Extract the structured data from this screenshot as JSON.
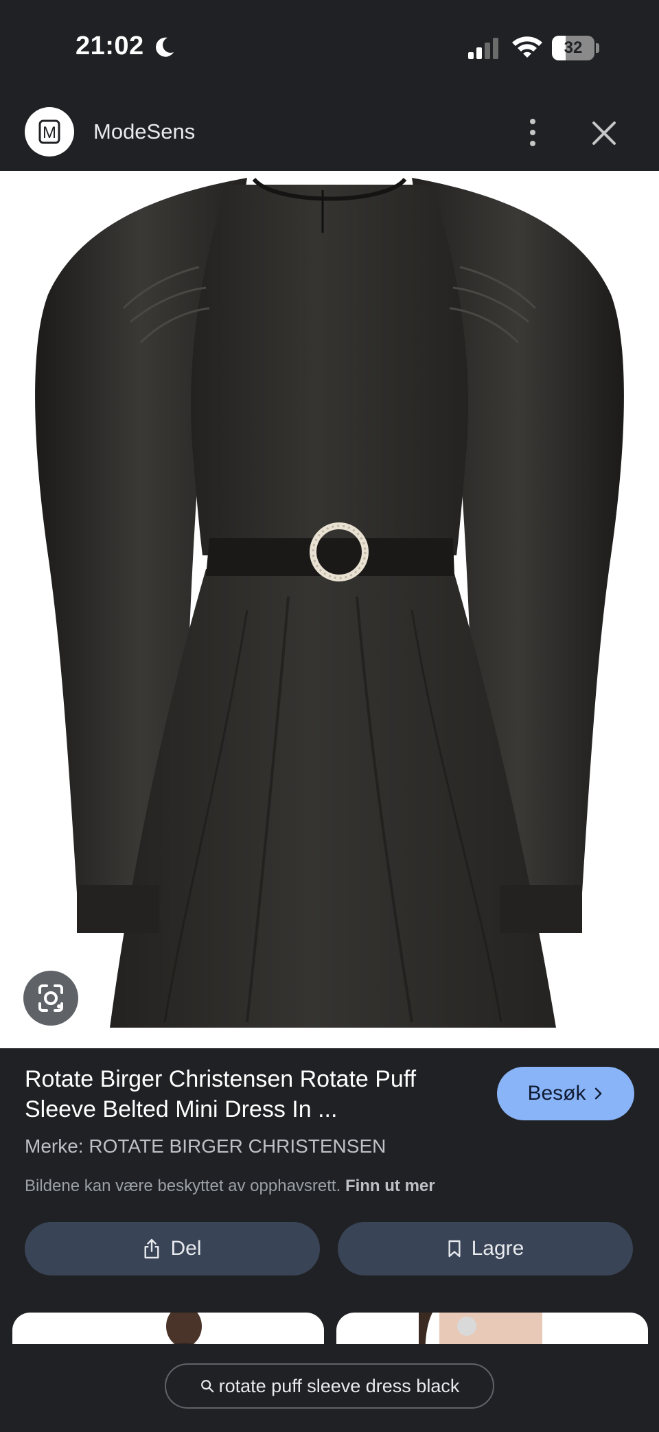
{
  "status_bar": {
    "time": "21:02",
    "battery_level": "32",
    "icons": [
      "moon-icon",
      "signal-icon",
      "wifi-icon",
      "battery-icon"
    ]
  },
  "header": {
    "site_name": "ModeSens",
    "logo_letter": "M",
    "icons": [
      "more-vert-icon",
      "close-icon"
    ]
  },
  "product": {
    "image_description_icon": "lens-icon",
    "title": "Rotate Birger Christensen Rotate Puff Sleeve Belted Mini Dress In ...",
    "visit_label": "Besøk",
    "brand": "Merke: ROTATE BIRGER CHRISTENSEN",
    "copyright_text": "Bildene kan være beskyttet av opphavsrett.",
    "copyright_link": "Finn ut mer"
  },
  "actions": {
    "share_label": "Del",
    "save_label": "Lagre"
  },
  "search": {
    "query": "rotate puff sleeve dress black"
  },
  "colors": {
    "background": "#202124",
    "accent_button": "#8ab4f8",
    "secondary_button": "#394457",
    "dress": "#2b2a28",
    "buckle": "#e9e1d2"
  }
}
